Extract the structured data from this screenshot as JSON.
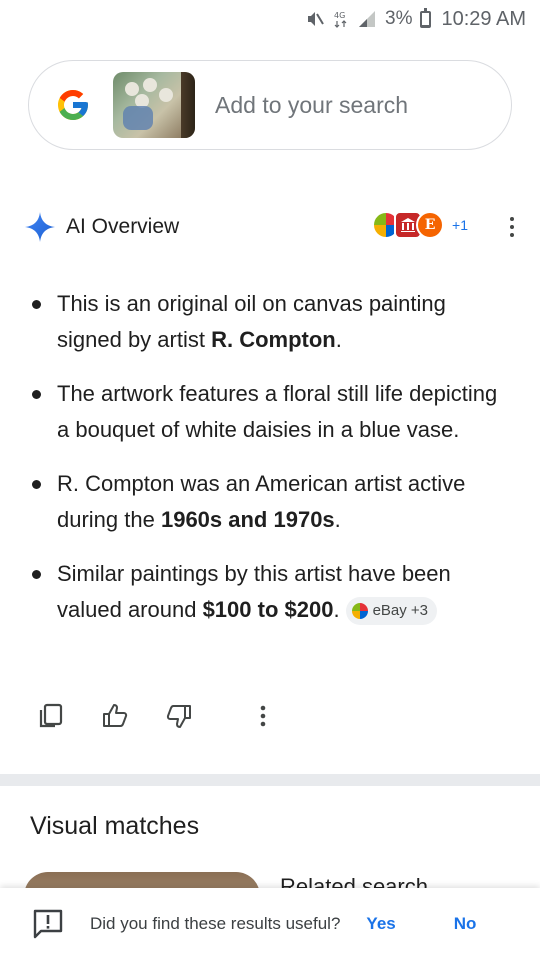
{
  "status_bar": {
    "battery": "3%",
    "battery_level": 0.03,
    "time": "10:29 AM",
    "icons": [
      "mute-icon",
      "data-icon",
      "signal-icon",
      "battery-icon"
    ]
  },
  "search": {
    "placeholder": "Add to your search",
    "logo": "google-g-icon",
    "thumbnail": "painting-thumbnail"
  },
  "ai_overview": {
    "title": "AI Overview",
    "sources_count": "+1",
    "source_letter": "E",
    "bullets": [
      {
        "text": "This is an original oil on canvas painting signed by artist ",
        "bold": "R. Compton",
        "after": "."
      },
      {
        "text": "The artwork features a floral still life depicting a bouquet of white daisies in a blue vase.",
        "bold": "",
        "after": ""
      },
      {
        "text": "R. Compton was an American artist active during the ",
        "bold": "1960s and 1970s",
        "after": "."
      },
      {
        "text": "Similar paintings by this artist have been valued around ",
        "bold": "$100 to $200",
        "after": "."
      }
    ],
    "chip": "eBay +3"
  },
  "actions": [
    "copy-icon",
    "thumbs-up-icon",
    "thumbs-down-icon",
    "more-icon"
  ],
  "visual_matches": {
    "title": "Visual matches",
    "related": "Related search"
  },
  "feedback": {
    "question": "Did you find these results useful?",
    "yes": "Yes",
    "no": "No"
  },
  "colors": {
    "link_blue": "#1a73e8",
    "text": "#1f1f1f",
    "muted": "#70757a"
  }
}
